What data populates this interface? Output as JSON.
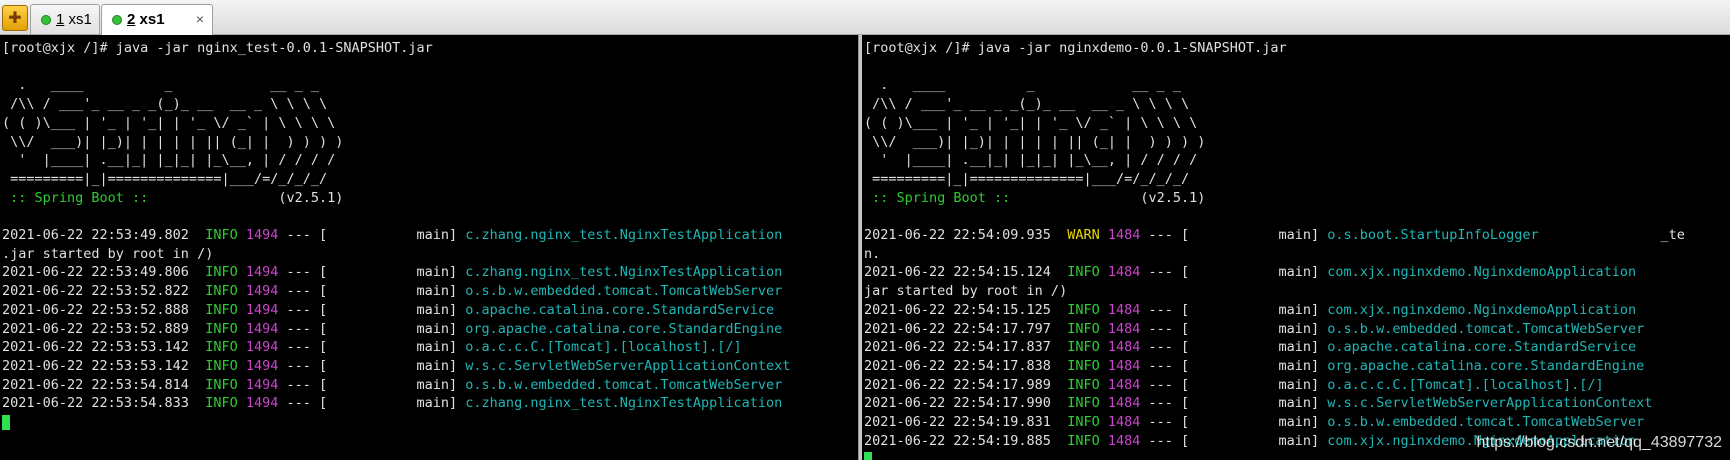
{
  "tabs": [
    {
      "num": "1",
      "name": " xs1",
      "active": false
    },
    {
      "num": "2",
      "name": " xs1",
      "active": true
    }
  ],
  "close_glyph": "×",
  "left": {
    "command": "[root@xjx /]# java -jar nginx_test-0.0.1-SNAPSHOT.jar",
    "banner": [
      "  .   ____          _            __ _ _",
      " /\\\\ / ___'_ __ _ _(_)_ __  __ _ \\ \\ \\ \\",
      "( ( )\\___ | '_ | '_| | '_ \\/ _` | \\ \\ \\ \\",
      " \\\\/  ___)| |_)| | | | | || (_| |  ) ) ) )",
      "  '  |____| .__|_| |_|_| |_\\__, | / / / /",
      " =========|_|==============|___/=/_/_/_/"
    ],
    "spring_label": " :: Spring Boot :: ",
    "spring_version": "               (v2.5.1)",
    "logs": [
      {
        "ts": "2021-06-22 22:53:49.802 ",
        "level": " INFO",
        "pid": " 1494",
        "sep": " --- [           main] ",
        "logger": "c.zhang.nginx_test.NginxTestApplication"
      },
      {
        "cont": ".jar started by root in /)"
      },
      {
        "ts": "2021-06-22 22:53:49.806 ",
        "level": " INFO",
        "pid": " 1494",
        "sep": " --- [           main] ",
        "logger": "c.zhang.nginx_test.NginxTestApplication"
      },
      {
        "ts": "2021-06-22 22:53:52.822 ",
        "level": " INFO",
        "pid": " 1494",
        "sep": " --- [           main] ",
        "logger": "o.s.b.w.embedded.tomcat.TomcatWebServer"
      },
      {
        "ts": "2021-06-22 22:53:52.888 ",
        "level": " INFO",
        "pid": " 1494",
        "sep": " --- [           main] ",
        "logger": "o.apache.catalina.core.StandardService"
      },
      {
        "ts": "2021-06-22 22:53:52.889 ",
        "level": " INFO",
        "pid": " 1494",
        "sep": " --- [           main] ",
        "logger": "org.apache.catalina.core.StandardEngine"
      },
      {
        "ts": "2021-06-22 22:53:53.142 ",
        "level": " INFO",
        "pid": " 1494",
        "sep": " --- [           main] ",
        "logger": "o.a.c.c.C.[Tomcat].[localhost].[/]"
      },
      {
        "ts": "2021-06-22 22:53:53.142 ",
        "level": " INFO",
        "pid": " 1494",
        "sep": " --- [           main] ",
        "logger": "w.s.c.ServletWebServerApplicationContext"
      },
      {
        "ts": "2021-06-22 22:53:54.814 ",
        "level": " INFO",
        "pid": " 1494",
        "sep": " --- [           main] ",
        "logger": "o.s.b.w.embedded.tomcat.TomcatWebServer"
      },
      {
        "ts": "2021-06-22 22:53:54.833 ",
        "level": " INFO",
        "pid": " 1494",
        "sep": " --- [           main] ",
        "logger": "c.zhang.nginx_test.NginxTestApplication"
      }
    ]
  },
  "right": {
    "command": "[root@xjx /]# java -jar nginxdemo-0.0.1-SNAPSHOT.jar",
    "banner": [
      "  .   ____          _            __ _ _",
      " /\\\\ / ___'_ __ _ _(_)_ __  __ _ \\ \\ \\ \\",
      "( ( )\\___ | '_ | '_| | '_ \\/ _` | \\ \\ \\ \\",
      " \\\\/  ___)| |_)| | | | | || (_| |  ) ) ) )",
      "  '  |____| .__|_| |_|_| |_\\__, | / / / /",
      " =========|_|==============|___/=/_/_/_/"
    ],
    "spring_label": " :: Spring Boot :: ",
    "spring_version": "               (v2.5.1)",
    "logs": [
      {
        "ts": "2021-06-22 22:54:09.935 ",
        "level": " WARN",
        "pid": " 1484",
        "sep": " --- [           main] ",
        "logger": "o.s.boot.StartupInfoLogger",
        "tail": "               _te"
      },
      {
        "cont": "n."
      },
      {
        "ts": "2021-06-22 22:54:15.124 ",
        "level": " INFO",
        "pid": " 1484",
        "sep": " --- [           main] ",
        "logger": "com.xjx.nginxdemo.NginxdemoApplication"
      },
      {
        "cont": "jar started by root in /)"
      },
      {
        "ts": "2021-06-22 22:54:15.125 ",
        "level": " INFO",
        "pid": " 1484",
        "sep": " --- [           main] ",
        "logger": "com.xjx.nginxdemo.NginxdemoApplication"
      },
      {
        "ts": "2021-06-22 22:54:17.797 ",
        "level": " INFO",
        "pid": " 1484",
        "sep": " --- [           main] ",
        "logger": "o.s.b.w.embedded.tomcat.TomcatWebServer"
      },
      {
        "ts": "2021-06-22 22:54:17.837 ",
        "level": " INFO",
        "pid": " 1484",
        "sep": " --- [           main] ",
        "logger": "o.apache.catalina.core.StandardService"
      },
      {
        "ts": "2021-06-22 22:54:17.838 ",
        "level": " INFO",
        "pid": " 1484",
        "sep": " --- [           main] ",
        "logger": "org.apache.catalina.core.StandardEngine"
      },
      {
        "ts": "2021-06-22 22:54:17.989 ",
        "level": " INFO",
        "pid": " 1484",
        "sep": " --- [           main] ",
        "logger": "o.a.c.c.C.[Tomcat].[localhost].[/]"
      },
      {
        "ts": "2021-06-22 22:54:17.990 ",
        "level": " INFO",
        "pid": " 1484",
        "sep": " --- [           main] ",
        "logger": "w.s.c.ServletWebServerApplicationContext"
      },
      {
        "ts": "2021-06-22 22:54:19.831 ",
        "level": " INFO",
        "pid": " 1484",
        "sep": " --- [           main] ",
        "logger": "o.s.b.w.embedded.tomcat.TomcatWebServer"
      },
      {
        "ts": "2021-06-22 22:54:19.885 ",
        "level": " INFO",
        "pid": " 1484",
        "sep": " --- [           main] ",
        "logger": "com.xjx.nginxdemo.NginxdemoApplication"
      }
    ]
  },
  "watermark": "https://blog.csdn.net/qq_43897732",
  "colors": {
    "info": "#2fcc33",
    "warn": "#e6d800",
    "pid": "#cc44cc",
    "logger": "#1fb6b6"
  }
}
